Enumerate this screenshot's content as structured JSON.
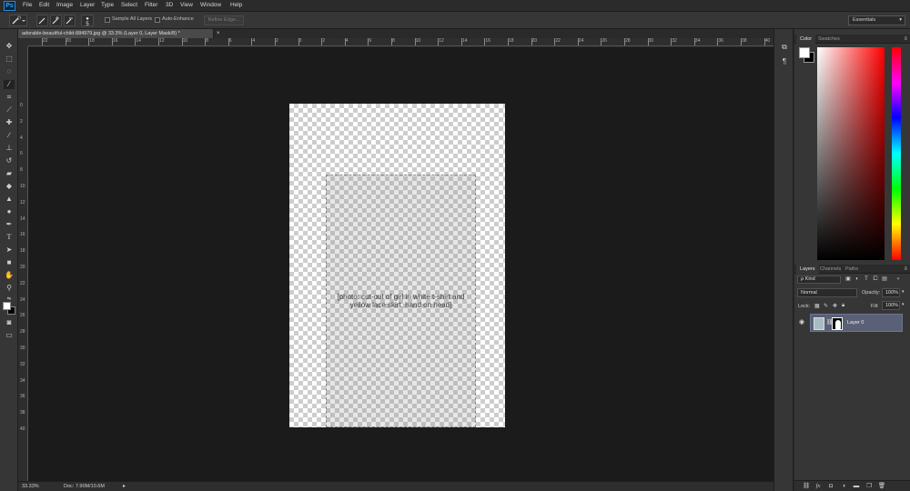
{
  "app": {
    "logo": "Ps"
  },
  "menu": [
    "File",
    "Edit",
    "Image",
    "Layer",
    "Type",
    "Select",
    "Filter",
    "3D",
    "View",
    "Window",
    "Help"
  ],
  "options_bar": {
    "brush_size": "5",
    "sample_all_layers": "Sample All Layers",
    "auto_enhance": "Auto-Enhance",
    "refine_edge": "Refine Edge...",
    "workspace": "Essentials"
  },
  "document": {
    "tab_title": "adorable-beautiful-child-884979.jpg @ 33.3% (Layer 0, Layer Mask/8) *",
    "close": "×",
    "zoom": "33.33%",
    "doc_size": "Doc: 7.90M/10.6M",
    "photo_placeholder": "[photo: cut-out of girl in white t-shirt and yellow lace skirt, hand on head]"
  },
  "rulers": {
    "top": [
      "22",
      "20",
      "18",
      "16",
      "14",
      "12",
      "10",
      "8",
      "6",
      "4",
      "2",
      "0",
      "2",
      "4",
      "6",
      "8",
      "10",
      "12",
      "14",
      "16",
      "18",
      "20",
      "22",
      "24",
      "26",
      "28",
      "30",
      "32",
      "34",
      "36",
      "38",
      "40"
    ],
    "left": [
      "0",
      "2",
      "4",
      "6",
      "8",
      "10",
      "12",
      "14",
      "16",
      "18",
      "20",
      "22",
      "24",
      "26",
      "28",
      "30",
      "32",
      "34",
      "36",
      "38",
      "40"
    ]
  },
  "color_panel": {
    "tabs": [
      "Color",
      "Swatches"
    ],
    "foreground": "#ffffff",
    "background": "#000000"
  },
  "layers_panel": {
    "tabs": [
      "Layers",
      "Channels",
      "Paths"
    ],
    "filter_kind": "ρ Kind",
    "blend_mode": "Normal",
    "opacity_label": "Opacity:",
    "opacity_value": "100%",
    "lock_label": "Lock:",
    "fill_label": "Fill:",
    "fill_value": "100%",
    "layers": [
      {
        "name": "Layer 0",
        "visible": true,
        "selected": true
      }
    ]
  },
  "colors": {
    "selection": "#5a6075",
    "canvas": "#1b1b1b",
    "panel": "#363636"
  }
}
